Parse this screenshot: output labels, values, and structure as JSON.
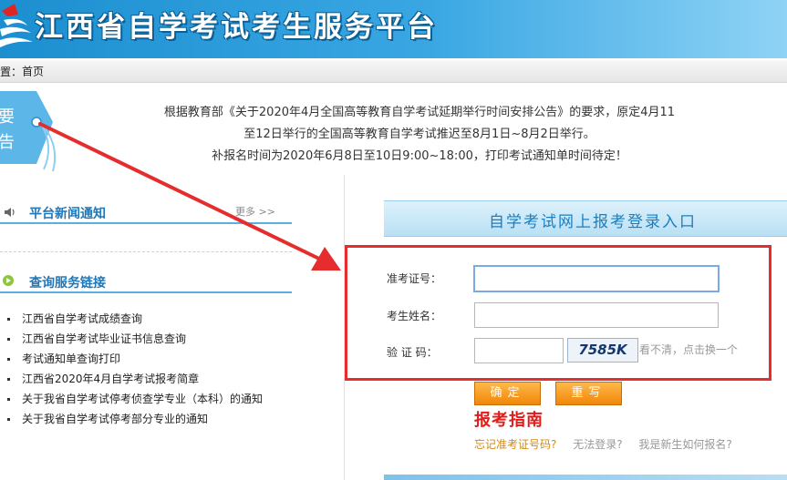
{
  "header": {
    "title": "江西省自学考试考生服务平台"
  },
  "breadcrumb": {
    "prefix": "位置：",
    "current": "首页"
  },
  "notice_tag": {
    "line1": "要",
    "line2": "告"
  },
  "notice": {
    "lines": [
      "根据教育部《关于2020年4月全国高等教育自学考试延期举行时间安排公告》的要求，原定4月11",
      "至12日举行的全国高等教育自学考试推迟至8月1日~8月2日举行。",
      "补报名时间为2020年6月8日至10日9:00~18:00，打印考试通知单时间待定！"
    ]
  },
  "news": {
    "title": "平台新闻通知",
    "more": "更多 >>"
  },
  "query": {
    "title": "查询服务链接",
    "items": [
      "江西省自学考试成绩查询",
      "江西省自学考试毕业证书信息查询",
      "考试通知单查询打印",
      "江西省2020年4月自学考试报考简章",
      "关于我省自学考试停考侦查学专业（本科）的通知",
      "关于我省自学考试停考部分专业的通知"
    ]
  },
  "login": {
    "banner": "自学考试网上报考登录入口",
    "ticket_label": "准考证号：",
    "name_label": "考生姓名：",
    "captcha_label": "验 证 码：",
    "captcha_text": "7585K",
    "captcha_hint": "看不清，点击换一个",
    "ticket_value": "",
    "name_value": "",
    "captcha_value": "",
    "confirm": "确定",
    "reset": "重写"
  },
  "guide": {
    "title": "报考指南"
  },
  "help_links": {
    "forgot": "忘记准考证号码?",
    "cannot_login": "无法登录?",
    "new_student": "我是新生如何报名?"
  },
  "colors": {
    "header": "#1c8fd0",
    "accent": "#2277b8",
    "annotation": "#e52d2d",
    "button": "#f08708"
  }
}
